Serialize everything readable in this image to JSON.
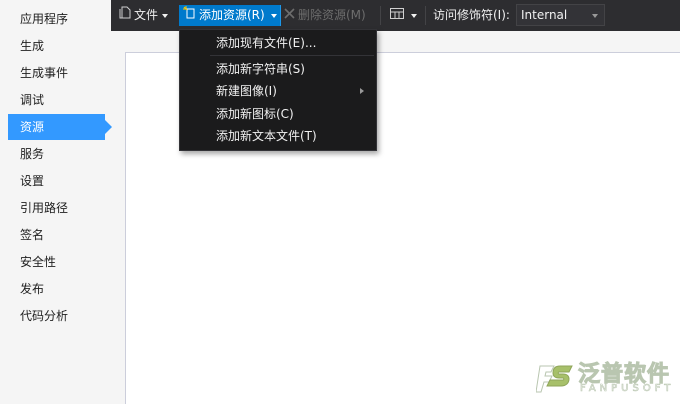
{
  "sidebar": {
    "items": [
      {
        "label": "应用程序"
      },
      {
        "label": "生成"
      },
      {
        "label": "生成事件"
      },
      {
        "label": "调试"
      },
      {
        "label": "资源",
        "active": true
      },
      {
        "label": "服务"
      },
      {
        "label": "设置"
      },
      {
        "label": "引用路径"
      },
      {
        "label": "签名"
      },
      {
        "label": "安全性"
      },
      {
        "label": "发布"
      },
      {
        "label": "代码分析"
      }
    ]
  },
  "toolbar": {
    "file_label": "文件",
    "add_resource_label": "添加资源(R)",
    "remove_resource_label": "删除资源(M)",
    "access_modifier_label": "访问修饰符(I):",
    "access_modifier_value": "Internal"
  },
  "menu": {
    "items": [
      {
        "label": "添加现有文件(E)..."
      },
      {
        "label": "添加新字符串(S)"
      },
      {
        "label": "新建图像(I)",
        "has_submenu": true
      },
      {
        "label": "添加新图标(C)"
      },
      {
        "label": "添加新文本文件(T)"
      }
    ]
  },
  "watermark": {
    "main": "泛普软件",
    "sub": "FANPUSOFT"
  },
  "colors": {
    "toolbar_bg": "#2d2d30",
    "accent": "#007acc",
    "sidebar_active": "#3399ff",
    "menu_bg": "#1b1b1c"
  }
}
